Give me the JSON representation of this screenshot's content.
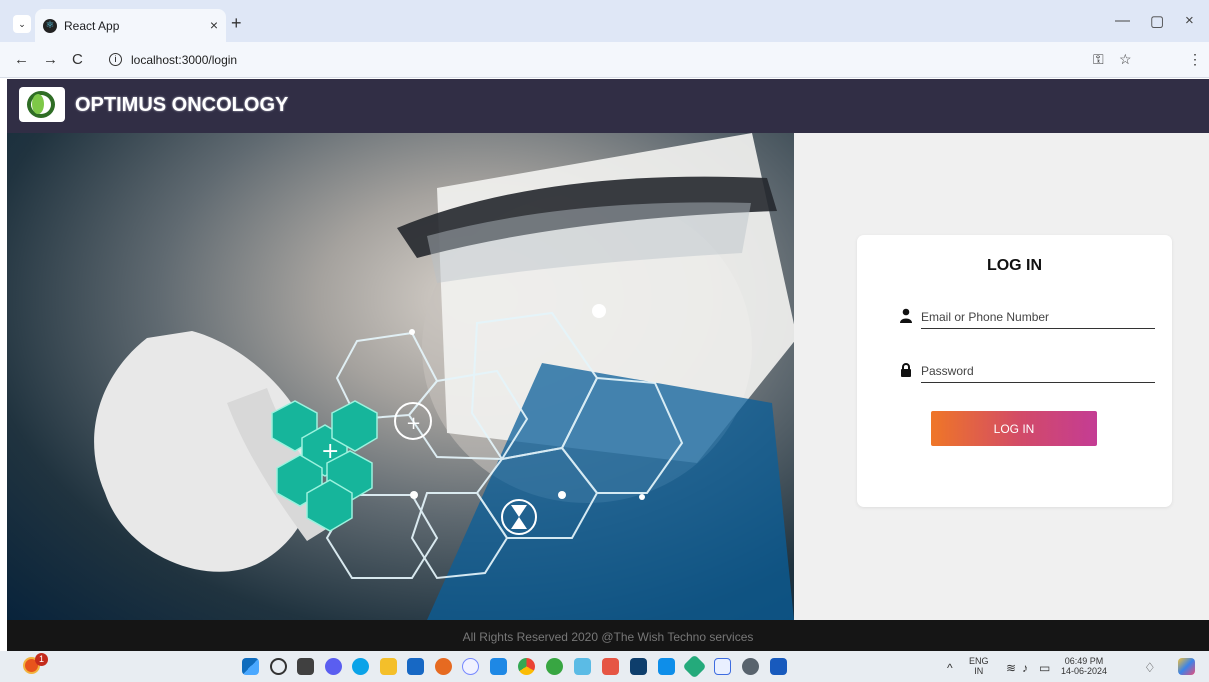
{
  "browser": {
    "tab": {
      "title": "React App",
      "close": "×"
    },
    "new_tab": "+",
    "window_controls": {
      "minimize": "—",
      "restore": "▢",
      "close": "×"
    },
    "nav": {
      "back": "←",
      "forward": "→",
      "reload": "C"
    },
    "url": "localhost:3000/login",
    "info": "i",
    "right_icons": {
      "password": "⚿",
      "star": "☆",
      "menu": "⋮"
    }
  },
  "app": {
    "brand": "OPTIMUS ONCOLOGY"
  },
  "login": {
    "title": "LOG IN",
    "email_placeholder": "Email or Phone Number",
    "password_placeholder": "Password",
    "button": "LOG IN"
  },
  "footer": {
    "text": "All Rights Reserved 2020 @The Wish Techno services"
  },
  "taskbar": {
    "notification": "1",
    "apps": [
      "windows",
      "search",
      "task view",
      "video",
      "edge",
      "folder",
      "store",
      "firefox",
      "browser",
      "terminal",
      "chrome",
      "grammar",
      "photos",
      "tools",
      "monitor",
      "vscode",
      "git",
      "notes",
      "settings",
      "word"
    ],
    "tray": {
      "expand": "^",
      "lang": "ENG",
      "lang_sub": "IN",
      "time": "06:49 PM",
      "date": "14-06-2024"
    }
  },
  "colors": {
    "header": "#312e45",
    "button_start": "#ef7627",
    "button_end": "#c43c94",
    "footer": "#151515"
  }
}
